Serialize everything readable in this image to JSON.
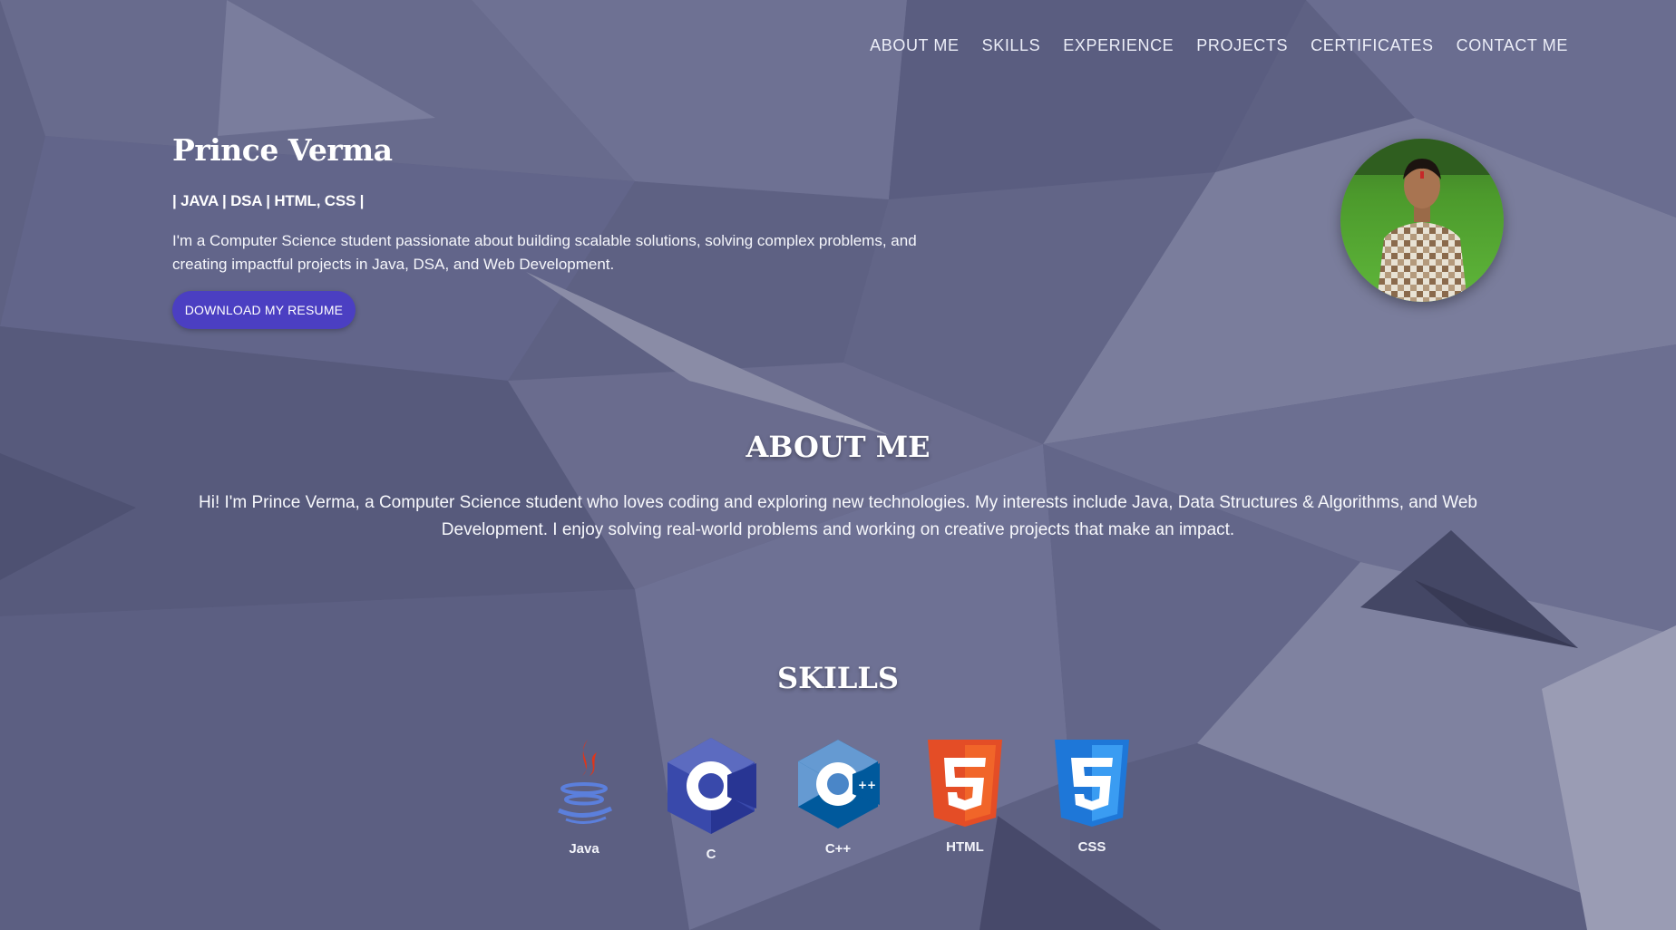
{
  "nav": {
    "items": [
      {
        "label": "ABOUT ME"
      },
      {
        "label": "SKILLS"
      },
      {
        "label": "EXPERIENCE"
      },
      {
        "label": "PROJECTS"
      },
      {
        "label": "CERTIFICATES"
      },
      {
        "label": "CONTACT ME"
      }
    ]
  },
  "hero": {
    "name": "Prince Verma",
    "tags": "| JAVA | DSA | HTML, CSS |",
    "description": "I'm a Computer Science student passionate about building scalable solutions, solving complex problems, and creating impactful projects in Java, DSA, and Web Development.",
    "resume_button": "DOWNLOAD MY RESUME",
    "button_color": "#4b3fc2"
  },
  "about": {
    "title": "ABOUT ME",
    "text": "Hi! I'm Prince Verma, a Computer Science student who loves coding and exploring new technologies. My interests include Java, Data Structures & Algorithms, and Web Development. I enjoy solving real-world problems and working on creative projects that make an impact."
  },
  "skills": {
    "title": "SKILLS",
    "items": [
      {
        "label": "Java",
        "icon": "java-icon"
      },
      {
        "label": "C",
        "icon": "c-icon"
      },
      {
        "label": "C++",
        "icon": "cpp-icon"
      },
      {
        "label": "HTML",
        "icon": "html5-icon"
      },
      {
        "label": "CSS",
        "icon": "css3-icon"
      }
    ]
  },
  "colors": {
    "background": "#5e6183",
    "html_orange": "#e44d26",
    "css_blue": "#2a8cf0",
    "c_blue": "#3949ab",
    "java_red": "#e0361a",
    "java_blue": "#5b7fdc"
  }
}
